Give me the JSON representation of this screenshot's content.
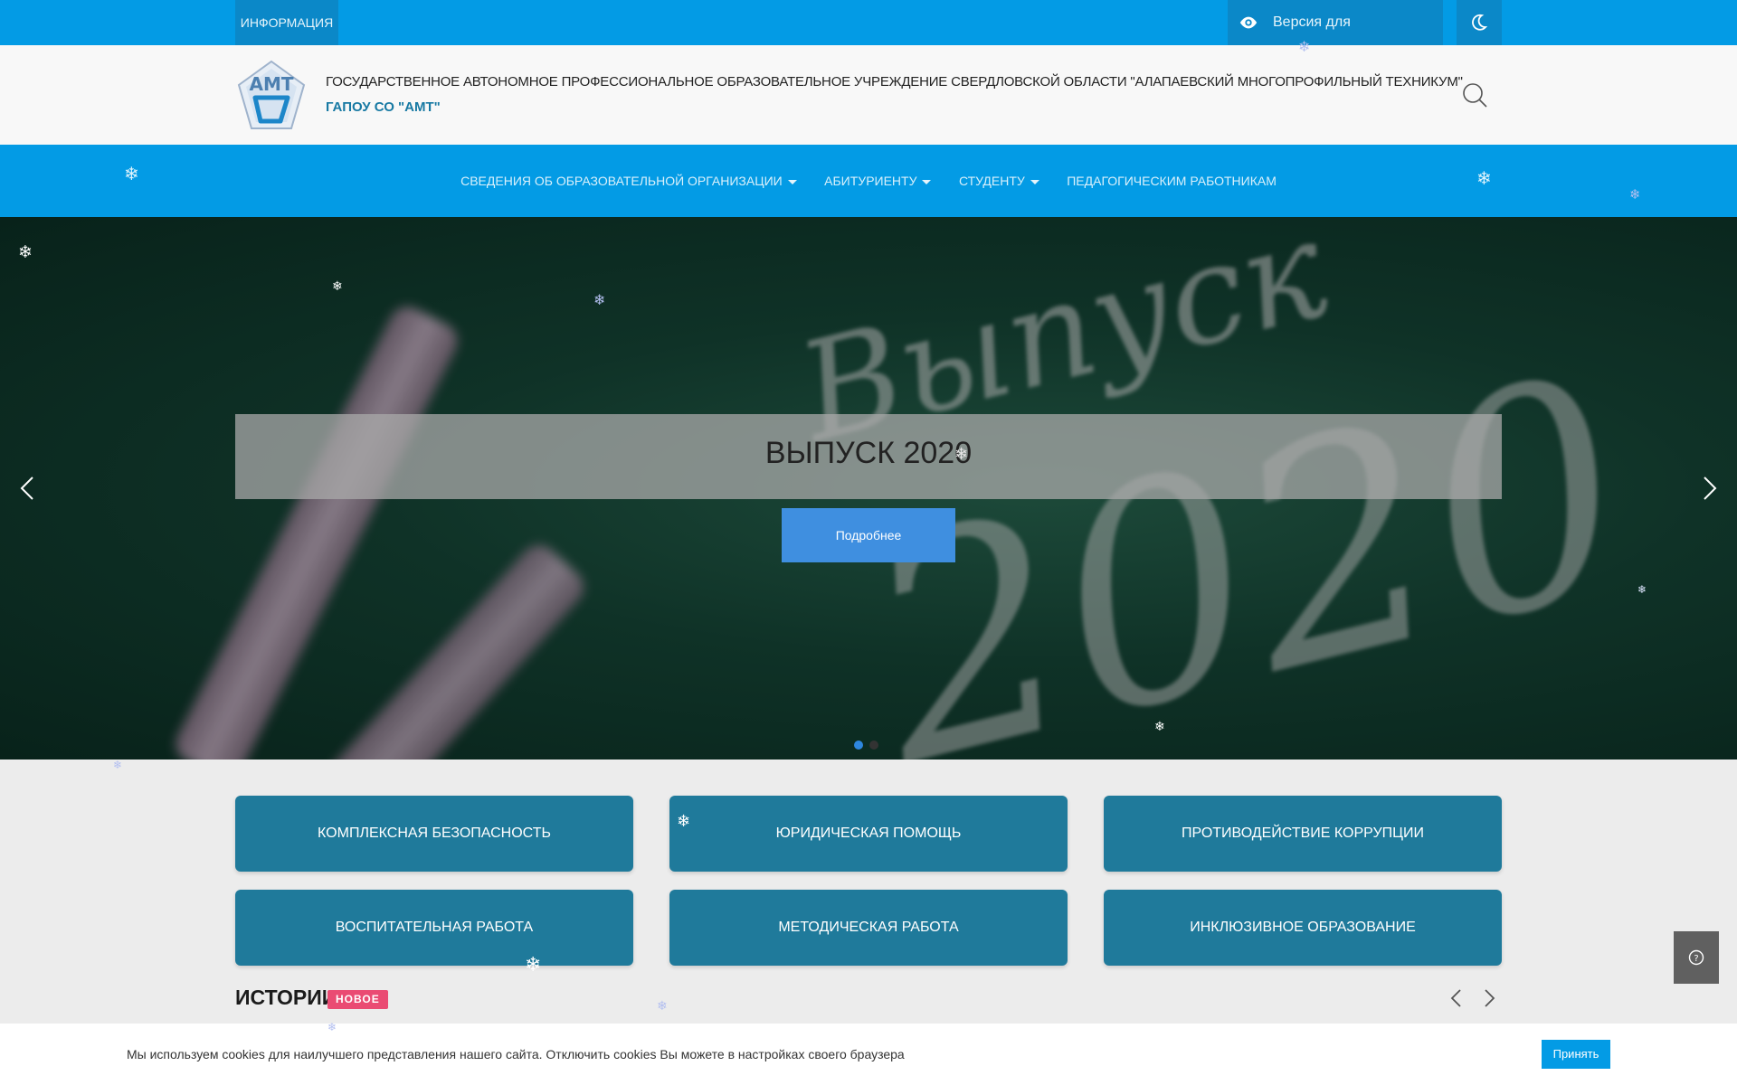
{
  "topbar": {
    "info_label": "ИНФОРМАЦИЯ",
    "vision_label": "Версия для слабовидящих",
    "eye_icon": "eye-icon",
    "theme_icon": "moon-icon"
  },
  "header": {
    "org_name": "ГОСУДАРСТВЕННОЕ АВТОНОМНОЕ ПРОФЕССИОНАЛЬНОЕ ОБРАЗОВАТЕЛЬНОЕ УЧРЕЖДЕНИЕ СВЕРДЛОВСКОЙ ОБЛАСТИ \"АЛАПАЕВСКИЙ МНОГОПРОФИЛЬНЫЙ ТЕХНИКУМ\"",
    "org_short": "ГАПОУ СО \"АМТ\"",
    "logo_text": "АМТ",
    "search_icon": "search-icon"
  },
  "nav": {
    "items": [
      {
        "label": "СВЕДЕНИЯ ОБ ОБРАЗОВАТЕЛЬНОЙ ОРГАНИЗАЦИИ"
      },
      {
        "label": "АБИТУРИЕНТУ"
      },
      {
        "label": "СТУДЕНТУ"
      },
      {
        "label": "ПЕДАГОГИЧЕСКИМ РАБОТНИКАМ"
      }
    ]
  },
  "hero": {
    "slide_title": "ВЫПУСК 2020",
    "more_label": "Подробнее",
    "art_word": "Выпуск",
    "art_year": "2020",
    "active_slide": 1,
    "slide_count": 2
  },
  "tiles": [
    {
      "label": "КОМПЛЕКСНАЯ БЕЗОПАСНОСТЬ"
    },
    {
      "label": "ЮРИДИЧЕСКАЯ ПОМОЩЬ"
    },
    {
      "label": "ПРОТИВОДЕЙСТВИЕ КОРРУПЦИИ"
    },
    {
      "label": "ВОСПИТАТЕЛЬНАЯ РАБОТА"
    },
    {
      "label": "МЕТОДИЧЕСКАЯ РАБОТА"
    },
    {
      "label": "ИНКЛЮЗИВНОЕ ОБРАЗОВАНИЕ"
    }
  ],
  "stories": {
    "title": "ИСТОРИИ",
    "badge": "НОВОЕ"
  },
  "cookie": {
    "text": "Мы используем cookies для наилучшего представления нашего сайта. Отключить cookies Вы можете в настройках своего браузера",
    "accept_label": "Принять"
  },
  "colors": {
    "brand_blue": "#039be5",
    "tile_blue": "#1f7a9b",
    "badge_pink": "#ea4b73",
    "active_dot": "#2e86de"
  }
}
